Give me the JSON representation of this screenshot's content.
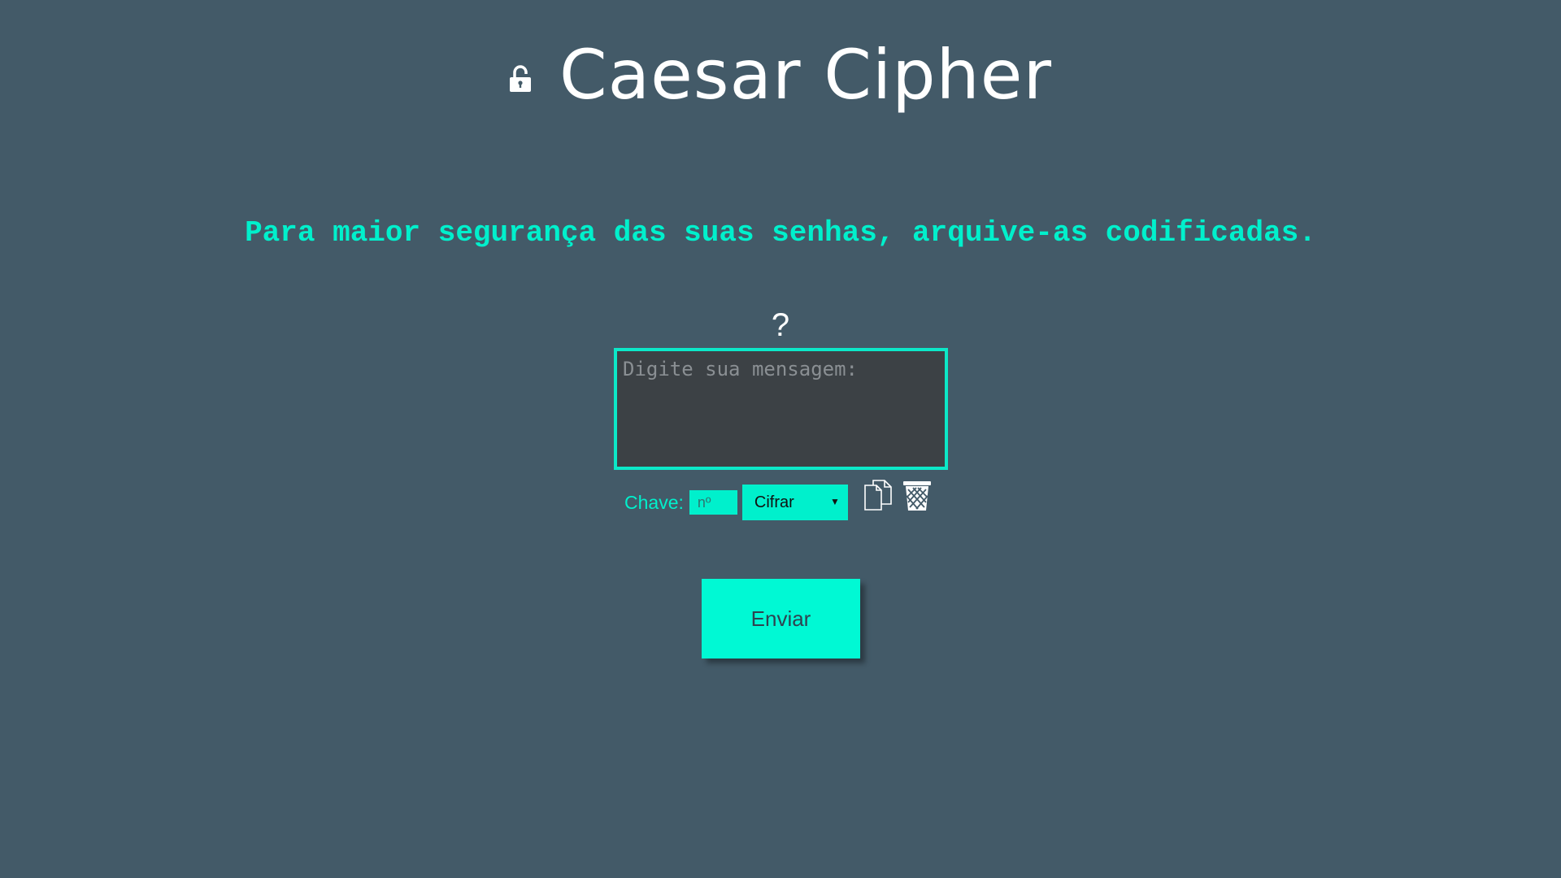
{
  "header": {
    "title": "Caesar Cipher",
    "icon": "unlocked-padlock-icon"
  },
  "subtitle": "Para maior segurança das suas senhas, arquive-as codificadas.",
  "help": {
    "label": "?"
  },
  "message": {
    "value": "",
    "placeholder": "Digite sua mensagem:"
  },
  "controls": {
    "key_label": "Chave:",
    "key_placeholder": "nº",
    "key_value": "",
    "mode_selected": "Cifrar",
    "copy_icon": "copy-icon",
    "clear_icon": "trash-icon"
  },
  "submit": {
    "label": "Enviar"
  },
  "colors": {
    "background": "#435a68",
    "accent": "#00f0cc",
    "textarea_bg": "#3c4145",
    "button": "#00f9d4"
  }
}
